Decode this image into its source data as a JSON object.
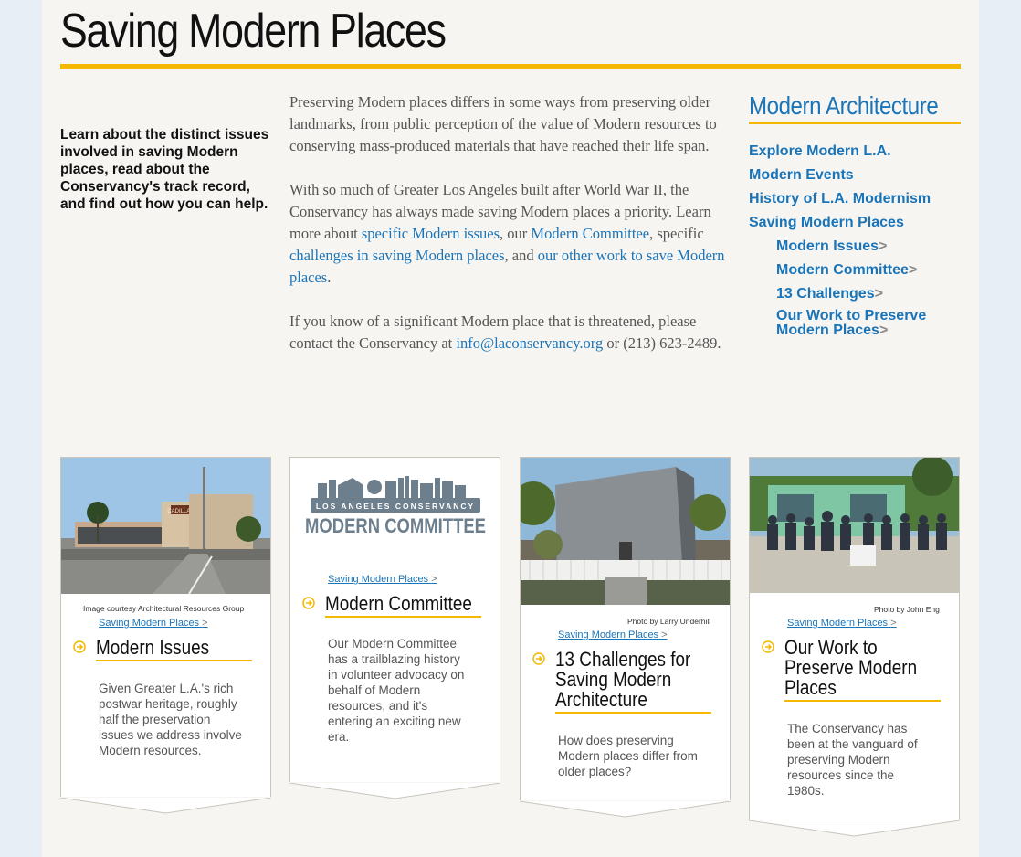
{
  "page": {
    "title": "Saving Modern Places",
    "intro": "Learn about the distinct issues involved in saving Modern places, read about the Conservancy's track record, and find out how you can help."
  },
  "body": {
    "p1": "Preserving Modern places differs in some ways from preserving older landmarks, from public perception of the value of Modern resources to conserving mass-produced materials that have reached their life span.",
    "p2_a": "With so much of Greater Los Angeles built after World War II, the Conservancy has always made saving Modern places a priority. Learn more about ",
    "p2_link1": "specific Modern issues",
    "p2_b": ", our ",
    "p2_link2": "Modern Committee",
    "p2_c": ", specific ",
    "p2_link3": "challenges in saving Modern places",
    "p2_d": ", and ",
    "p2_link4": "our other work to save Modern places",
    "p2_e": ".",
    "p3_a": "If you know of a significant Modern place that is threatened, please contact the Conservancy at ",
    "p3_email": "info@laconservancy.org",
    "p3_b": " or (213) 623-2489."
  },
  "sidebar": {
    "heading": "Modern Architecture",
    "items": [
      {
        "label": "Explore Modern L.A."
      },
      {
        "label": "Modern Events"
      },
      {
        "label": "History of L.A. Modernism"
      },
      {
        "label": "Saving Modern Places"
      }
    ],
    "subitems": [
      {
        "label": "Modern Issues",
        "arrow": ">"
      },
      {
        "label": "Modern Committee",
        "arrow": ">"
      },
      {
        "label": "13 Challenges",
        "arrow": ">"
      },
      {
        "label": "Our Work to Preserve Modern Places",
        "arrow": ">"
      }
    ]
  },
  "cards": [
    {
      "credit": "Image courtesy Architectural Resources Group",
      "crumb": "Saving Modern Places",
      "crumb_arrow": ">",
      "title": "Modern Issues",
      "desc": "Given Greater L.A.'s rich postwar heritage, roughly half the preservation issues we address involve Modern resources.",
      "sign_text": "CADILLAC"
    },
    {
      "logo_top": "LOS ANGELES CONSERVANCY",
      "logo_bottom": "MODERN COMMITTEE",
      "crumb": "Saving Modern Places",
      "crumb_arrow": ">",
      "title": "Modern Committee",
      "desc": "Our Modern Committee has a trailblazing history in volunteer advocacy on behalf of Modern resources, and it's entering an exciting new era."
    },
    {
      "credit": "Photo by Larry Underhill",
      "crumb": "Saving Modern Places",
      "crumb_arrow": ">",
      "title_lines": [
        "13 Challenges for",
        "Saving Modern",
        "Architecture"
      ],
      "desc": "How does preserving Modern places differ from older places?"
    },
    {
      "credit": "Photo by John Eng",
      "crumb": "Saving Modern Places",
      "crumb_arrow": ">",
      "title_lines": [
        "Our Work to",
        "Preserve Modern",
        "Places"
      ],
      "desc": "The Conservancy has been at the vanguard of preserving Modern resources since the 1980s."
    }
  ],
  "colors": {
    "accent": "#f5b800",
    "link": "#1a74b8",
    "text": "#555555"
  }
}
